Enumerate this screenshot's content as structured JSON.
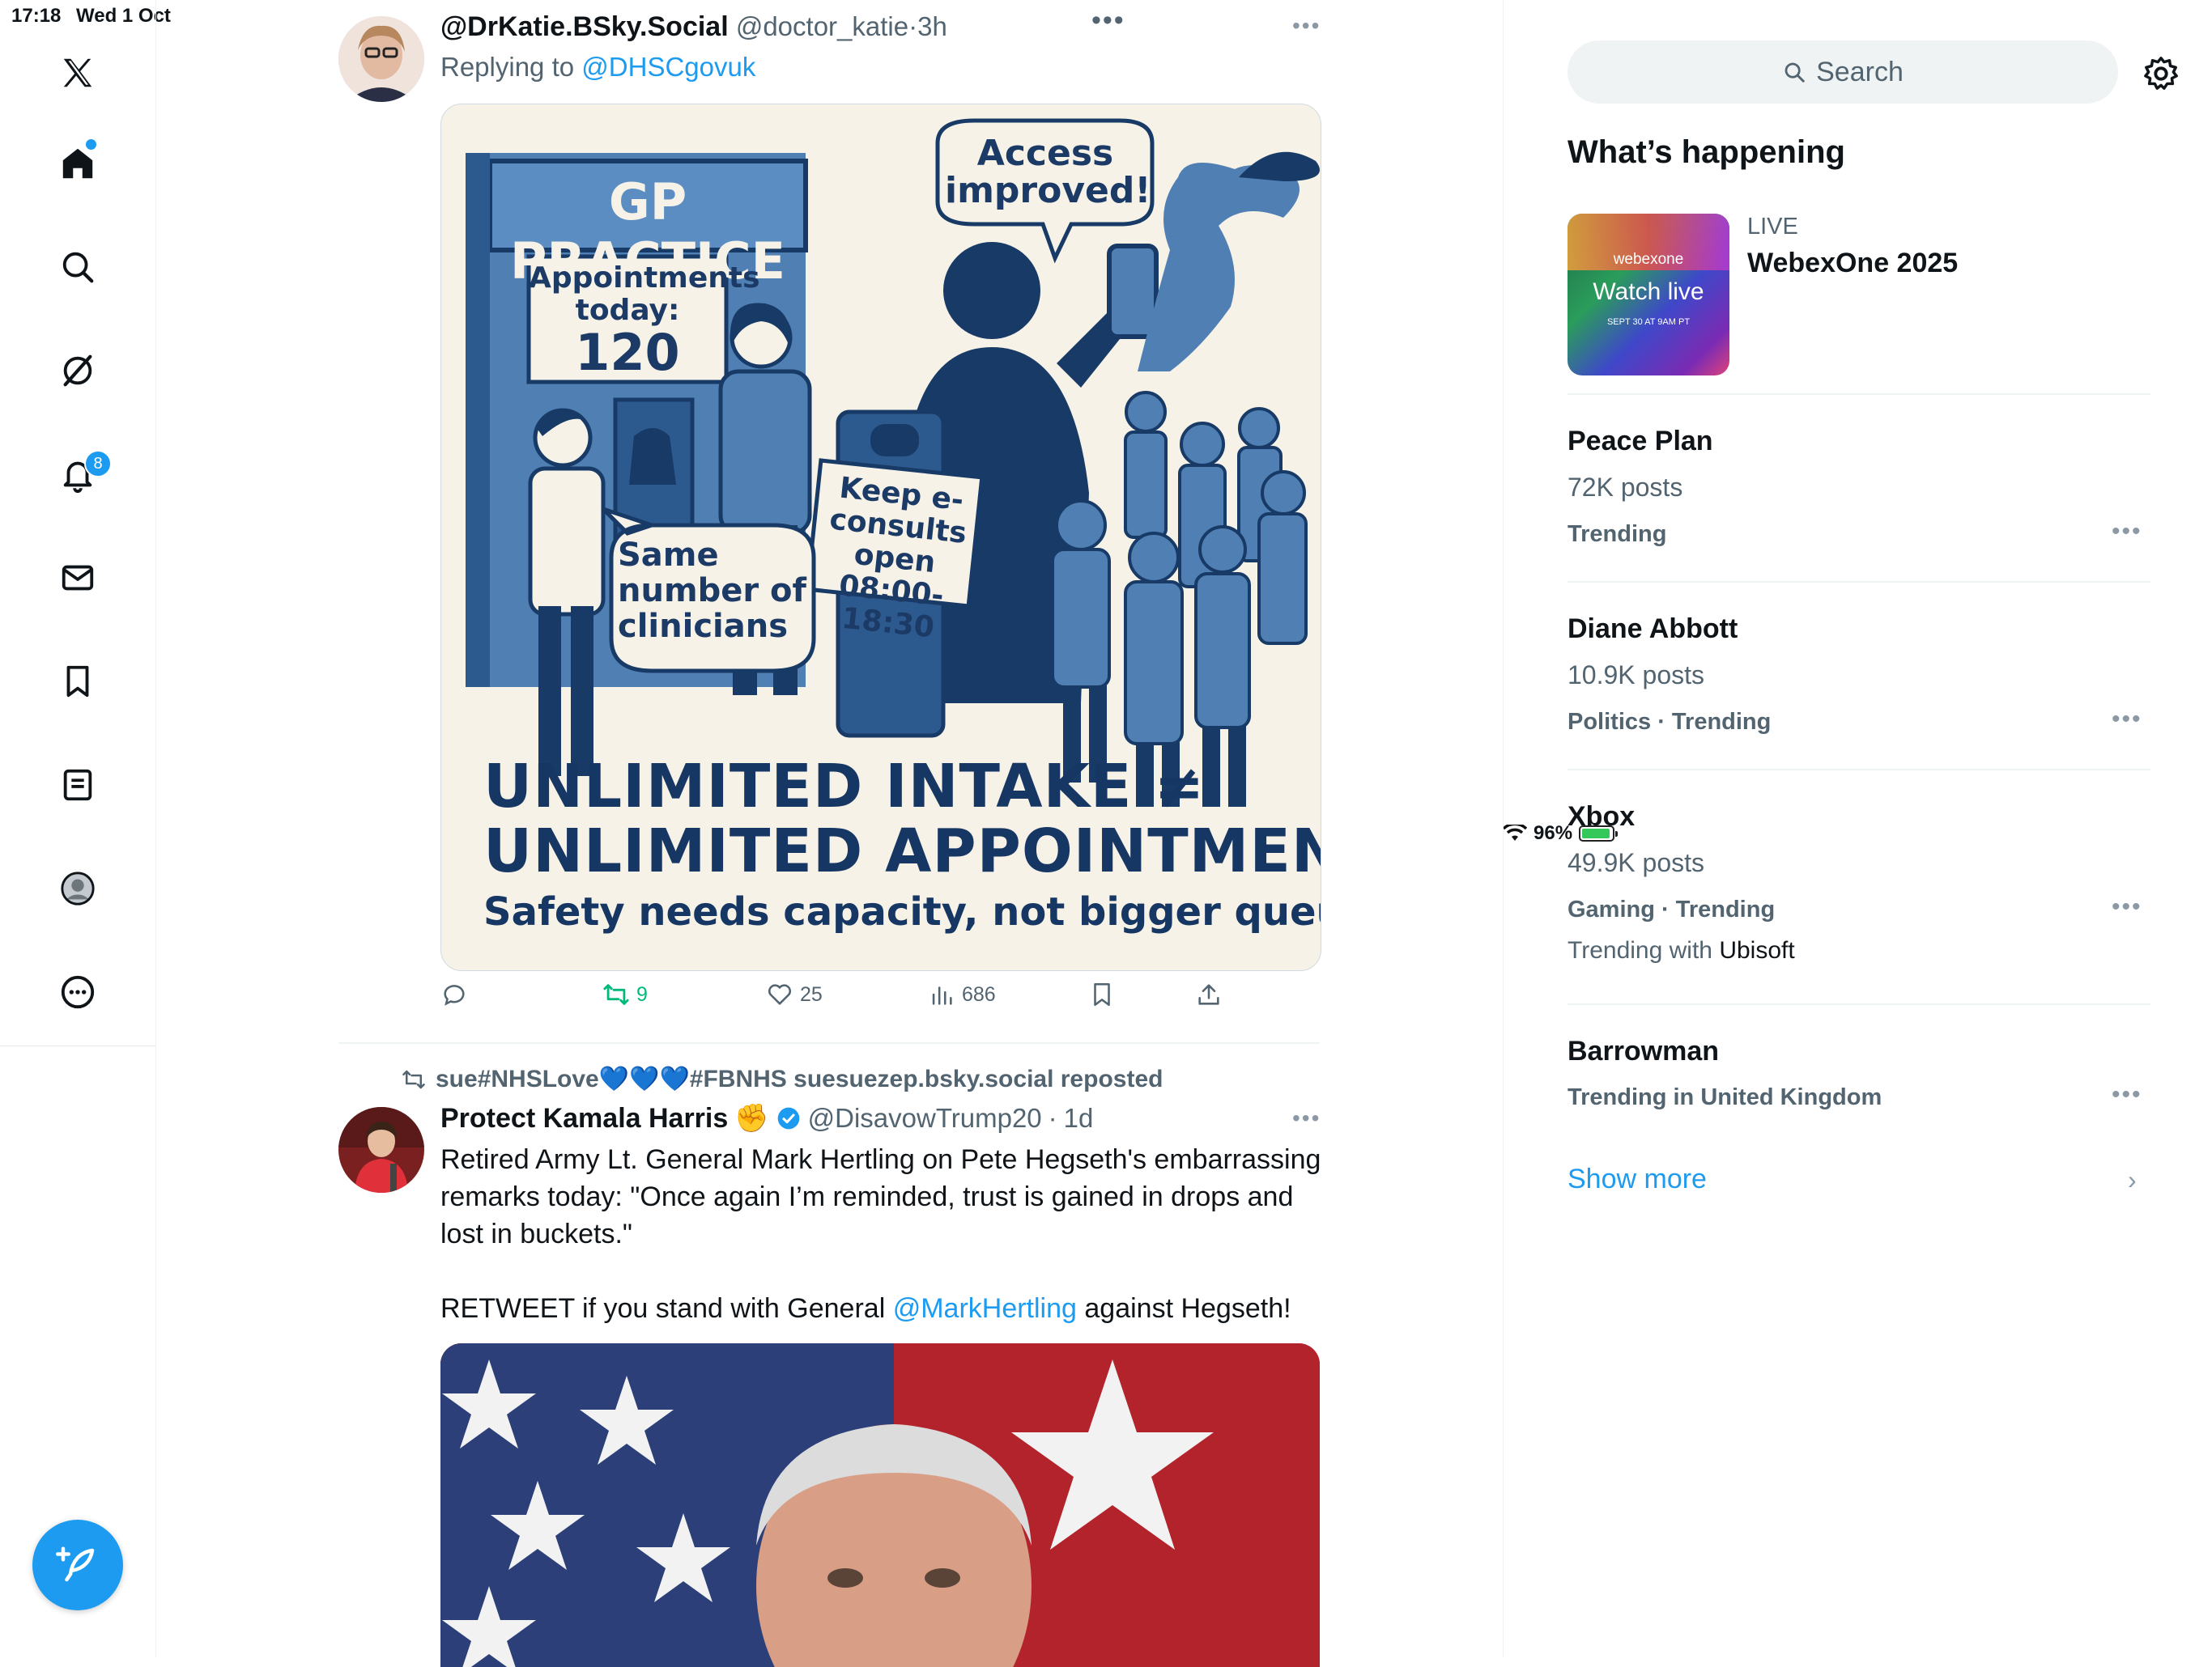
{
  "status_bar": {
    "time": "17:18",
    "date": "Wed 1 Oct",
    "battery": "96%"
  },
  "nav": {
    "notifications_badge": "8",
    "items": [
      "x-logo-icon",
      "home-icon",
      "search-icon",
      "grok-icon",
      "bell-icon",
      "mail-icon",
      "bookmark-icon",
      "lists-icon",
      "profile-icon",
      "more-icon"
    ]
  },
  "tweet1": {
    "display_name": "@DrKatie.BSky.Social",
    "handle": "@doctor_katie",
    "sep": "·",
    "time": "3h",
    "replying_to_label": "Replying to",
    "replying_to_handle": "@DHSCgovuk",
    "image": {
      "sign": "GP PRACTICE",
      "board_line1": "Appointments",
      "board_line2": "today:",
      "board_value": "120",
      "bubble_access": "Access improved!",
      "bubble_same": "Same number of clinicians",
      "podium": "Keep e-consults open 08:00-18:30",
      "headline1": "UNLIMITED INTAKE ≠",
      "headline2": "UNLIMITED APPOINTMENTS",
      "subline": "Safety needs capacity, not bigger queues."
    },
    "stats": {
      "retweets": "9",
      "likes": "25",
      "views": "686"
    }
  },
  "tweet2": {
    "repost_label": "sue#NHSLove💙💙💙#FBNHS suesuezep.bsky.social reposted",
    "display_name": "Protect Kamala Harris",
    "emoji": "✊",
    "handle": "@DisavowTrump20",
    "sep": "·",
    "time": "1d",
    "body_main": "Retired Army Lt. General Mark Hertling on Pete Hegseth's embarrassing remarks today: \"Once again I’m reminded, trust is gained in drops and lost in buckets.\"\n\nRETWEET if you stand with General ",
    "body_link": "@MarkHertling",
    "body_end": " against Hegseth!"
  },
  "sidebar": {
    "search_placeholder": "Search",
    "whats_happening": "What’s happening",
    "live": {
      "label": "LIVE",
      "title": "WebexOne 2025",
      "thumb_brand": "webexone",
      "thumb_cta": "Watch live",
      "thumb_date": "SEPT 30 AT 9AM PT"
    },
    "trends": [
      {
        "name": "Peace Plan",
        "count": "72K posts",
        "category": "Trending"
      },
      {
        "name": "Diane Abbott",
        "count": "10.9K posts",
        "category": "Politics · Trending"
      },
      {
        "name": "Xbox",
        "count": "49.9K posts",
        "category": "Gaming · Trending",
        "extra_prefix": "Trending with",
        "extra_name": "Ubisoft"
      },
      {
        "name": "Barrowman",
        "category": "Trending in United Kingdom"
      }
    ],
    "show_more": "Show more"
  }
}
